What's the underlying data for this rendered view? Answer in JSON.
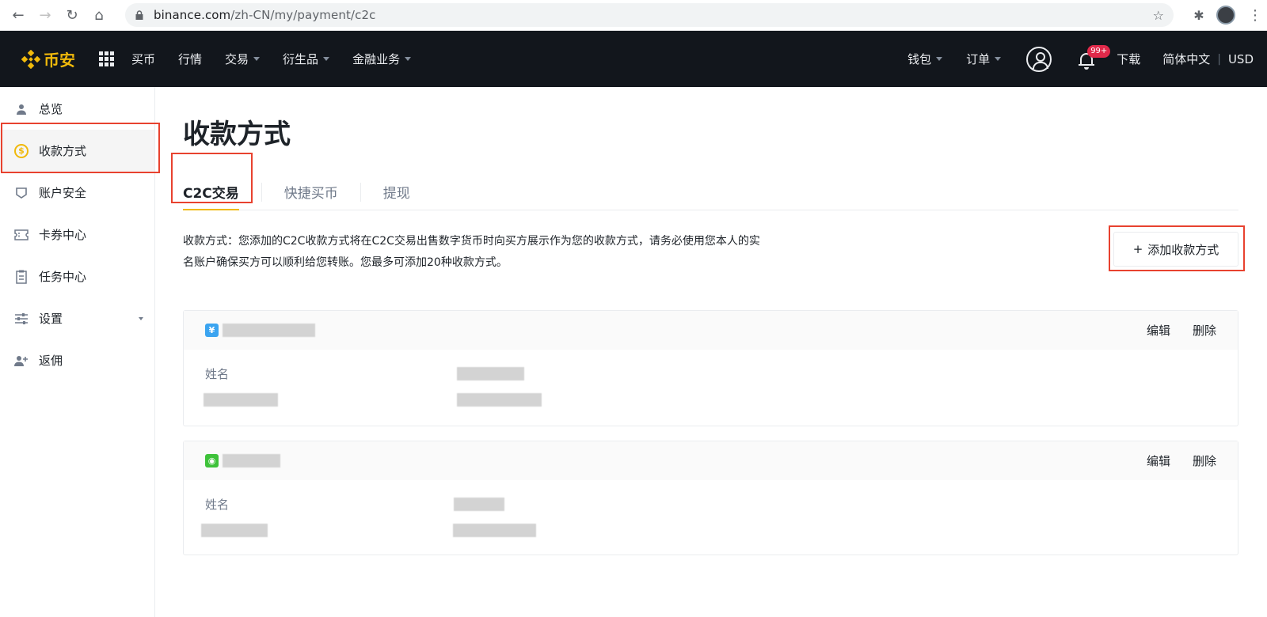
{
  "browser": {
    "url_host": "binance.com",
    "url_path": "/zh-CN/my/payment/c2c"
  },
  "topnav": {
    "brand": "币安",
    "items": [
      {
        "label": "买币",
        "dropdown": false
      },
      {
        "label": "行情",
        "dropdown": false
      },
      {
        "label": "交易",
        "dropdown": true
      },
      {
        "label": "衍生品",
        "dropdown": true
      },
      {
        "label": "金融业务",
        "dropdown": true
      }
    ],
    "wallet": "钱包",
    "orders": "订单",
    "notification_badge": "99+",
    "download": "下载",
    "language": "简体中文",
    "currency": "USD",
    "accent_color": "#f0b90b"
  },
  "sidebar": {
    "items": [
      {
        "label": "总览",
        "icon": "user-icon"
      },
      {
        "label": "收款方式",
        "icon": "dollar-coin-icon",
        "active": true
      },
      {
        "label": "账户安全",
        "icon": "shield-icon"
      },
      {
        "label": "卡券中心",
        "icon": "ticket-icon"
      },
      {
        "label": "任务中心",
        "icon": "clipboard-icon"
      },
      {
        "label": "设置",
        "icon": "sliders-icon",
        "dropdown": true
      },
      {
        "label": "返佣",
        "icon": "add-user-icon"
      }
    ]
  },
  "main": {
    "title": "收款方式",
    "tabs": [
      {
        "label": "C2C交易",
        "active": true
      },
      {
        "label": "快捷买币"
      },
      {
        "label": "提现"
      }
    ],
    "description_line1": "收款方式：您添加的C2C收款方式将在C2C交易出售数字货币时向买方展示作为您的收款方式，请务必使用您本人的实",
    "description_line2": "名账户确保买方可以顺利给您转账。您最多可添加20种收款方式。",
    "add_button": "添加收款方式",
    "cards": [
      {
        "icon": "alipay-icon",
        "icon_glyph": "¥",
        "edit": "编辑",
        "delete": "删除",
        "name_label": "姓名"
      },
      {
        "icon": "wechat-icon",
        "icon_glyph": "◉",
        "edit": "编辑",
        "delete": "删除",
        "name_label": "姓名"
      }
    ]
  }
}
